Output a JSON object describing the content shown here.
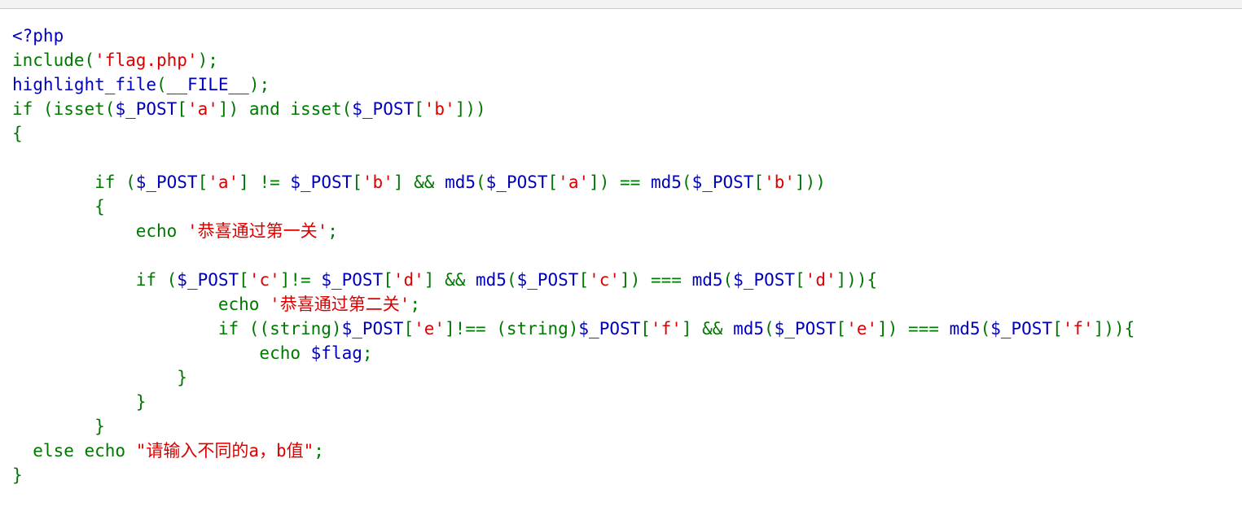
{
  "colors": {
    "default": "#0000BB",
    "keyword": "#007700",
    "string": "#DD0000",
    "background": "#FFFFFF"
  },
  "code_lines": [
    [
      {
        "t": "def",
        "v": "<?php"
      }
    ],
    [
      {
        "t": "kw",
        "v": "include("
      },
      {
        "t": "str",
        "v": "'flag.php'"
      },
      {
        "t": "kw",
        "v": ");"
      }
    ],
    [
      {
        "t": "def",
        "v": "highlight_file"
      },
      {
        "t": "kw",
        "v": "("
      },
      {
        "t": "def",
        "v": "__FILE__"
      },
      {
        "t": "kw",
        "v": ");"
      }
    ],
    [
      {
        "t": "kw",
        "v": "if (isset("
      },
      {
        "t": "def",
        "v": "$_POST"
      },
      {
        "t": "kw",
        "v": "["
      },
      {
        "t": "str",
        "v": "'a'"
      },
      {
        "t": "kw",
        "v": "]) and isset("
      },
      {
        "t": "def",
        "v": "$_POST"
      },
      {
        "t": "kw",
        "v": "["
      },
      {
        "t": "str",
        "v": "'b'"
      },
      {
        "t": "kw",
        "v": "]))"
      }
    ],
    [
      {
        "t": "kw",
        "v": "{"
      }
    ],
    [],
    [
      {
        "t": "kw",
        "v": "        if ("
      },
      {
        "t": "def",
        "v": "$_POST"
      },
      {
        "t": "kw",
        "v": "["
      },
      {
        "t": "str",
        "v": "'a'"
      },
      {
        "t": "kw",
        "v": "] != "
      },
      {
        "t": "def",
        "v": "$_POST"
      },
      {
        "t": "kw",
        "v": "["
      },
      {
        "t": "str",
        "v": "'b'"
      },
      {
        "t": "kw",
        "v": "] && "
      },
      {
        "t": "def",
        "v": "md5"
      },
      {
        "t": "kw",
        "v": "("
      },
      {
        "t": "def",
        "v": "$_POST"
      },
      {
        "t": "kw",
        "v": "["
      },
      {
        "t": "str",
        "v": "'a'"
      },
      {
        "t": "kw",
        "v": "]) == "
      },
      {
        "t": "def",
        "v": "md5"
      },
      {
        "t": "kw",
        "v": "("
      },
      {
        "t": "def",
        "v": "$_POST"
      },
      {
        "t": "kw",
        "v": "["
      },
      {
        "t": "str",
        "v": "'b'"
      },
      {
        "t": "kw",
        "v": "]))"
      }
    ],
    [
      {
        "t": "kw",
        "v": "        {"
      }
    ],
    [
      {
        "t": "kw",
        "v": "            echo "
      },
      {
        "t": "str",
        "v": "'恭喜通过第一关'"
      },
      {
        "t": "kw",
        "v": ";"
      }
    ],
    [],
    [
      {
        "t": "kw",
        "v": "            if ("
      },
      {
        "t": "def",
        "v": "$_POST"
      },
      {
        "t": "kw",
        "v": "["
      },
      {
        "t": "str",
        "v": "'c'"
      },
      {
        "t": "kw",
        "v": "]!= "
      },
      {
        "t": "def",
        "v": "$_POST"
      },
      {
        "t": "kw",
        "v": "["
      },
      {
        "t": "str",
        "v": "'d'"
      },
      {
        "t": "kw",
        "v": "] && "
      },
      {
        "t": "def",
        "v": "md5"
      },
      {
        "t": "kw",
        "v": "("
      },
      {
        "t": "def",
        "v": "$_POST"
      },
      {
        "t": "kw",
        "v": "["
      },
      {
        "t": "str",
        "v": "'c'"
      },
      {
        "t": "kw",
        "v": "]) === "
      },
      {
        "t": "def",
        "v": "md5"
      },
      {
        "t": "kw",
        "v": "("
      },
      {
        "t": "def",
        "v": "$_POST"
      },
      {
        "t": "kw",
        "v": "["
      },
      {
        "t": "str",
        "v": "'d'"
      },
      {
        "t": "kw",
        "v": "])){"
      }
    ],
    [
      {
        "t": "kw",
        "v": "                    echo "
      },
      {
        "t": "str",
        "v": "'恭喜通过第二关'"
      },
      {
        "t": "kw",
        "v": ";"
      }
    ],
    [
      {
        "t": "kw",
        "v": "                    if ((string)"
      },
      {
        "t": "def",
        "v": "$_POST"
      },
      {
        "t": "kw",
        "v": "["
      },
      {
        "t": "str",
        "v": "'e'"
      },
      {
        "t": "kw",
        "v": "]!== (string)"
      },
      {
        "t": "def",
        "v": "$_POST"
      },
      {
        "t": "kw",
        "v": "["
      },
      {
        "t": "str",
        "v": "'f'"
      },
      {
        "t": "kw",
        "v": "] && "
      },
      {
        "t": "def",
        "v": "md5"
      },
      {
        "t": "kw",
        "v": "("
      },
      {
        "t": "def",
        "v": "$_POST"
      },
      {
        "t": "kw",
        "v": "["
      },
      {
        "t": "str",
        "v": "'e'"
      },
      {
        "t": "kw",
        "v": "]) === "
      },
      {
        "t": "def",
        "v": "md5"
      },
      {
        "t": "kw",
        "v": "("
      },
      {
        "t": "def",
        "v": "$_POST"
      },
      {
        "t": "kw",
        "v": "["
      },
      {
        "t": "str",
        "v": "'f'"
      },
      {
        "t": "kw",
        "v": "])){"
      }
    ],
    [
      {
        "t": "kw",
        "v": "                        echo "
      },
      {
        "t": "def",
        "v": "$flag"
      },
      {
        "t": "kw",
        "v": ";"
      }
    ],
    [
      {
        "t": "kw",
        "v": "                }"
      }
    ],
    [
      {
        "t": "kw",
        "v": "            }"
      }
    ],
    [
      {
        "t": "kw",
        "v": "        }"
      }
    ],
    [
      {
        "t": "kw",
        "v": "  else echo "
      },
      {
        "t": "str",
        "v": "\"请输入不同的a，b值\""
      },
      {
        "t": "kw",
        "v": ";"
      }
    ],
    [
      {
        "t": "kw",
        "v": "}"
      }
    ]
  ]
}
